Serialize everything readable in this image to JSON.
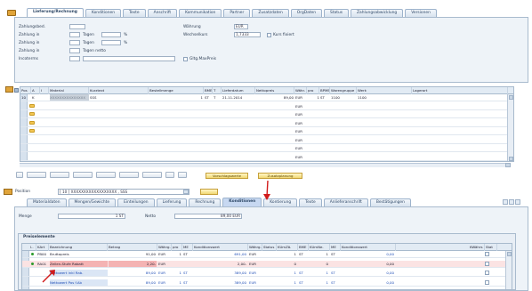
{
  "header_tabs": [
    "Lieferung/Rechnung",
    "Konditionen",
    "Texte",
    "Anschrift",
    "Kommunikation",
    "Partner",
    "Zusatzdaten",
    "OrgDaten",
    "Status",
    "Zahlungsabwicklung",
    "Versionen"
  ],
  "header_fields": {
    "zahlungsbed_label": "Zahlungsbed.",
    "zahlung_in_1_label": "Zahlung in",
    "zahlung_in_2_label": "Zahlung in",
    "zahlung_in_3_label": "Zahlung in",
    "incoterms_label": "Incoterms",
    "tagen": "Tagen",
    "tagen_netto": "Tagen netto",
    "percent": "%",
    "waehrung_label": "Währung",
    "waehrung_value": "EUR",
    "wechselkurs_label": "Wechselkurs",
    "wechselkurs_value": "1,7333",
    "kurs_fixiert": "Kurs fixiert",
    "gltg_maxpreis": "Gltg.MaxPreis"
  },
  "items_table": {
    "columns": [
      "Pos",
      "A",
      "I",
      "Material",
      "Kurztext",
      "Bestellmenge",
      "BME",
      "T",
      "Lieferdatum",
      "Nettopreis",
      "Währ.",
      "pro",
      "BPME",
      "Warengruppe",
      "Werk",
      "Lagerort"
    ],
    "rows": [
      {
        "pos": "10",
        "a": "K",
        "material": "XXXXXXXXXXXXXXX",
        "kurztext": "SSS",
        "menge": "1",
        "bme": "ST",
        "t": "T",
        "datum": "21.11.2014",
        "preis": "89,00",
        "waehr": "EUR",
        "pro": "1",
        "bpme": "ST",
        "wg": "1100",
        "werk": "1100"
      },
      {
        "waehr": "EUR"
      },
      {
        "waehr": "EUR"
      },
      {
        "waehr": "EUR"
      },
      {
        "waehr": "EUR"
      },
      {
        "waehr": "EUR"
      },
      {
        "waehr": "EUR"
      },
      {
        "waehr": "EUR"
      }
    ]
  },
  "toolbar": {
    "btn_vorgaengerwerte": "Vorschlagswerte",
    "btn_zusatzplanung": "Zusatzplanung"
  },
  "position": {
    "label": "Position",
    "select_value": "[ 10 ] XXXXXXXXXXXXXXXXXX , SSS"
  },
  "item_tabs": [
    "Materialdaten",
    "Mengen/Gewichte",
    "Einteilungen",
    "Lieferung",
    "Rechnung",
    "Konditionen",
    "Kontierung",
    "Texte",
    "Anlieferanschrift",
    "Bestätigungen"
  ],
  "item_fields": {
    "menge_label": "Menge",
    "menge_value": "1",
    "menge_unit": "ST",
    "netto_label": "Netto",
    "netto_value": "89,00",
    "netto_curr": "EUR"
  },
  "conditions": {
    "title": "Preiselemente",
    "columns": [
      "I..",
      "KArt",
      "Bezeichnung",
      "Betrag",
      "Währg.",
      "pro",
      "ME",
      "Konditionswert",
      "Währg.",
      "Status",
      "KUmZä.",
      "BME",
      "KUmNe.",
      "ME",
      "Konditionswert",
      "KWährs",
      "Stat"
    ],
    "rows": [
      {
        "kart": "PB00",
        "bez": "Bruttopreis",
        "betrag": "91,00",
        "waehr": "EUR",
        "pro": "1",
        "me": "ST",
        "kwert": "691,00",
        "kwaehr": "EUR",
        "kumza": "1",
        "bme": "ST",
        "kumne": "1",
        "me2": "ST",
        "kwert2": "0,00"
      },
      {
        "kart": "RA01",
        "bez": "Zeilen-Stufe Rabatt",
        "betrag": "2,20-",
        "waehr": "EUR",
        "pro": "",
        "me": "",
        "kwert": "2,00-",
        "kwaehr": "EUR",
        "kumza": "0",
        "bme": "",
        "kumne": "0",
        "me2": "",
        "kwert2": "0,00"
      },
      {
        "kart": "",
        "bez": "Nettowert inkl Rab.",
        "betrag": "89,00",
        "waehr": "EUR",
        "pro": "1",
        "me": "ST",
        "kwert": "389,00",
        "kwaehr": "EUR",
        "kumza": "1",
        "bme": "ST",
        "kumne": "1",
        "me2": "ST",
        "kwert2": "0,00"
      },
      {
        "kart": "",
        "bez": "Nettowert Pos f.Ab",
        "betrag": "89,00",
        "waehr": "EUR",
        "pro": "1",
        "me": "ST",
        "kwert": "389,00",
        "kwaehr": "EUR",
        "kumza": "1",
        "bme": "ST",
        "kumne": "1",
        "me2": "ST",
        "kwert2": "0,00"
      }
    ]
  },
  "colors": {
    "accent": "#2250b8",
    "highlight_red": "#f4b3b3",
    "arrow": "#d11a1a"
  }
}
